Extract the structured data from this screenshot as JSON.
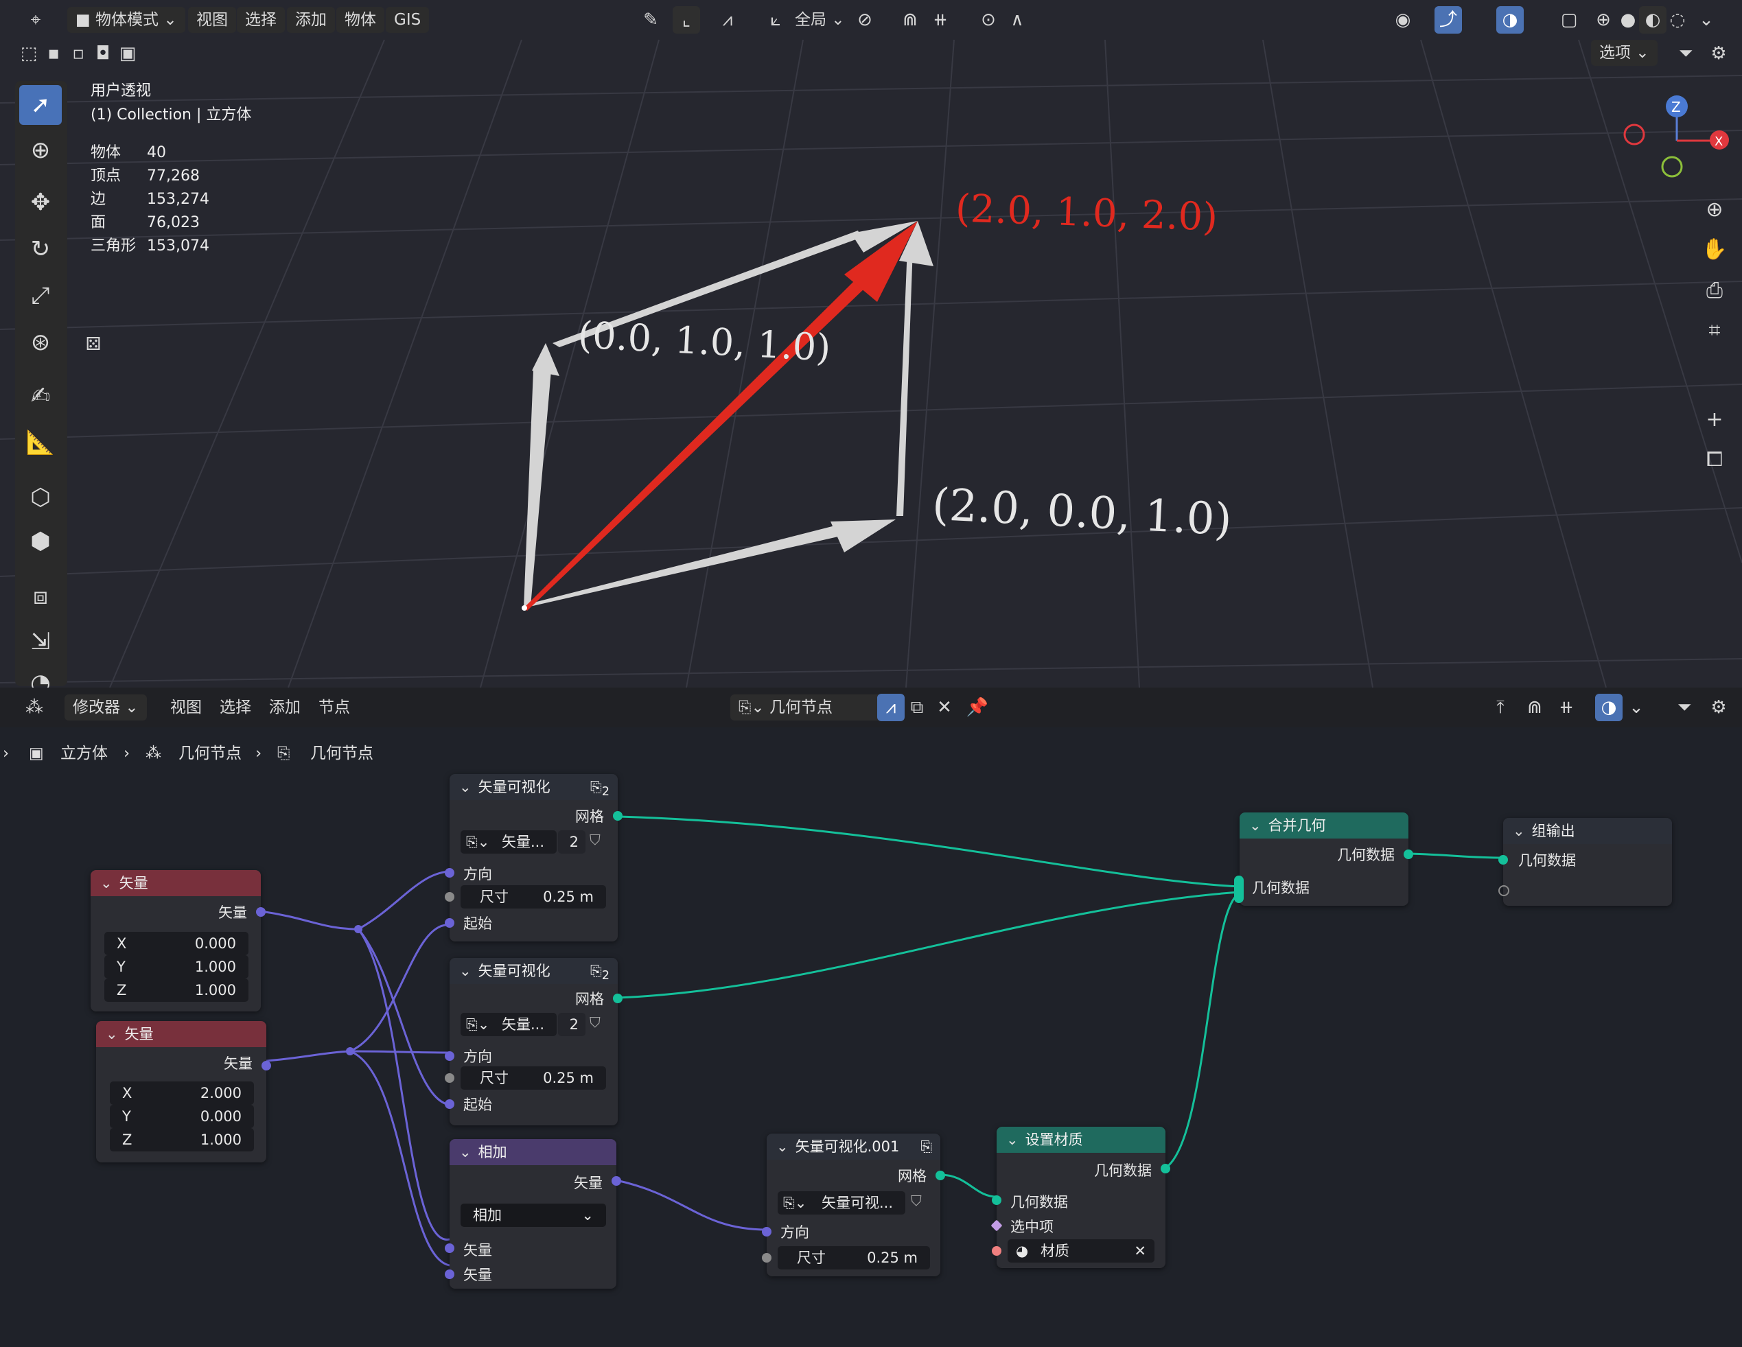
{
  "topbar": {
    "mode": "物体模式",
    "menus": [
      "视图",
      "选择",
      "添加",
      "物体",
      "GIS"
    ],
    "transform_orientation": "全局",
    "options": "选项"
  },
  "viewport": {
    "view_name": "用户透视",
    "collection_line": "(1) Collection | 立方体",
    "stats": [
      {
        "label": "物体",
        "value": "40"
      },
      {
        "label": "顶点",
        "value": "77,268"
      },
      {
        "label": "边",
        "value": "153,274"
      },
      {
        "label": "面",
        "value": "76,023"
      },
      {
        "label": "三角形",
        "value": "153,074"
      }
    ],
    "labels": {
      "sum": "(2.0,  1.0,  2.0)",
      "vec_a": "(0.0,  1.0,  1.0)",
      "vec_b": "(2.0,  0.0,  1.0)"
    },
    "axis_labels": {
      "z": "Z",
      "x": "X"
    },
    "colors": {
      "accent_red": "#e0291f",
      "arrow_white": "#cfcfcf",
      "grid": "#3a3b45"
    }
  },
  "editor": {
    "header": {
      "mode": "修改器",
      "menus": [
        "视图",
        "选择",
        "添加",
        "节点"
      ],
      "tree_name": "几何节点"
    },
    "breadcrumbs": [
      "立方体",
      "几何节点",
      "几何节点"
    ],
    "nodes": {
      "vec1": {
        "title": "矢量",
        "out": "矢量",
        "x_label": "X",
        "x": "0.000",
        "y_label": "Y",
        "y": "1.000",
        "z_label": "Z",
        "z": "1.000"
      },
      "vec2": {
        "title": "矢量",
        "out": "矢量",
        "x_label": "X",
        "x": "2.000",
        "y_label": "Y",
        "y": "0.000",
        "z_label": "Z",
        "z": "1.000"
      },
      "viz1": {
        "title": "矢量可视化",
        "out": "网格",
        "group": "矢量...",
        "users": "2",
        "dir": "方向",
        "size_label": "尺寸",
        "size": "0.25 m",
        "start": "起始",
        "badge": "2"
      },
      "viz2": {
        "title": "矢量可视化",
        "out": "网格",
        "group": "矢量...",
        "users": "2",
        "dir": "方向",
        "size_label": "尺寸",
        "size": "0.25 m",
        "start": "起始",
        "badge": "2"
      },
      "add": {
        "title": "相加",
        "out": "矢量",
        "op": "相加",
        "in1": "矢量",
        "in2": "矢量"
      },
      "viz3": {
        "title": "矢量可视化.001",
        "out": "网格",
        "group": "矢量可视...",
        "dir": "方向",
        "size_label": "尺寸",
        "size": "0.25 m"
      },
      "setmat": {
        "title": "设置材质",
        "out": "几何数据",
        "in_geo": "几何数据",
        "in_sel": "选中项",
        "mat": "材质"
      },
      "join": {
        "title": "合并几何",
        "out": "几何数据",
        "in": "几何数据"
      },
      "output": {
        "title": "组输出",
        "in": "几何数据"
      }
    }
  }
}
